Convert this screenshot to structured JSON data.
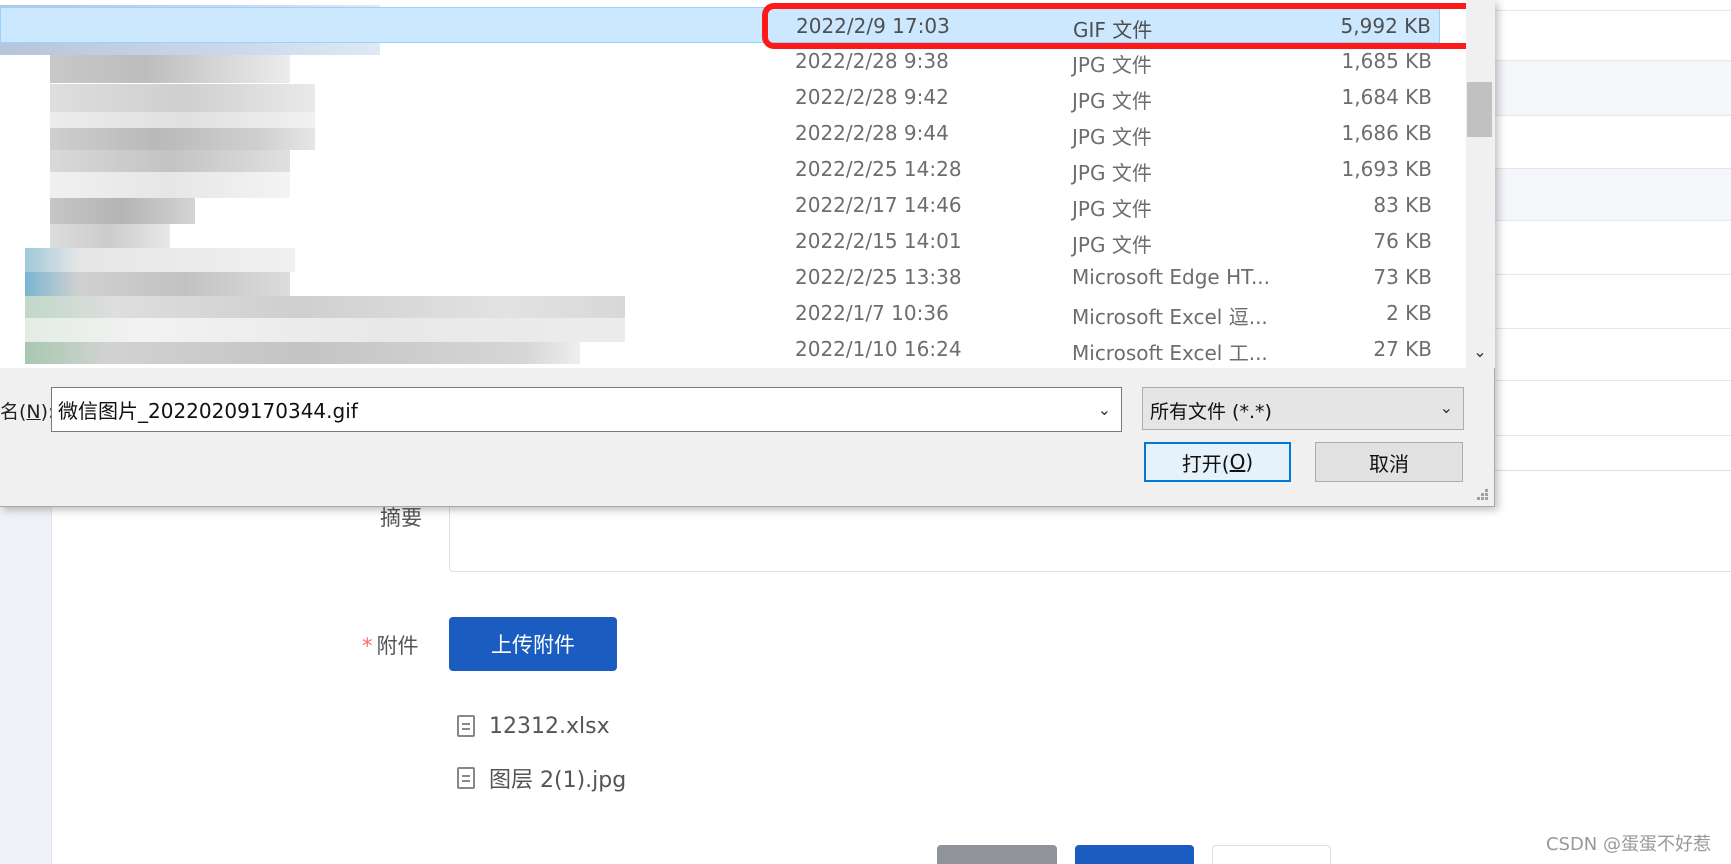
{
  "form": {
    "summary_label": "摘要",
    "attachment_required_mark": "*",
    "attachment_label": "附件",
    "upload_button": "上传附件",
    "attachments": [
      {
        "name": "12312.xlsx"
      },
      {
        "name": "图层 2(1).jpg"
      }
    ]
  },
  "dialog": {
    "files": [
      {
        "date": "2022/2/9 17:03",
        "type": "GIF 文件",
        "size": "5,992 KB",
        "selected": true
      },
      {
        "date": "2022/2/28 9:38",
        "type": "JPG 文件",
        "size": "1,685 KB"
      },
      {
        "date": "2022/2/28 9:42",
        "type": "JPG 文件",
        "size": "1,684 KB"
      },
      {
        "date": "2022/2/28 9:44",
        "type": "JPG 文件",
        "size": "1,686 KB"
      },
      {
        "date": "2022/2/25 14:28",
        "type": "JPG 文件",
        "size": "1,693 KB"
      },
      {
        "date": "2022/2/17 14:46",
        "type": "JPG 文件",
        "size": "83 KB"
      },
      {
        "date": "2022/2/15 14:01",
        "type": "JPG 文件",
        "size": "76 KB"
      },
      {
        "date": "2022/2/25 13:38",
        "type": "Microsoft Edge HT...",
        "size": "73 KB"
      },
      {
        "date": "2022/1/7 10:36",
        "type": "Microsoft Excel 逗...",
        "size": "2 KB"
      },
      {
        "date": "2022/1/10 16:24",
        "type": "Microsoft Excel 工...",
        "size": "27 KB"
      }
    ],
    "filename_label_prefix": "名(",
    "filename_label_key": "N",
    "filename_label_suffix": "):",
    "filename_value": "微信图片_20220209170344.gif",
    "filetype_filter": "所有文件 (*.*)",
    "open_button_prefix": "打开(",
    "open_button_key": "O",
    "open_button_suffix": ")",
    "cancel_button": "取消",
    "dropdown_icon": "chevron-down-icon",
    "highlight_color": "#ff1a1a",
    "selection_color": "#cce8ff"
  },
  "watermark": "CSDN @蛋蛋不好惹"
}
